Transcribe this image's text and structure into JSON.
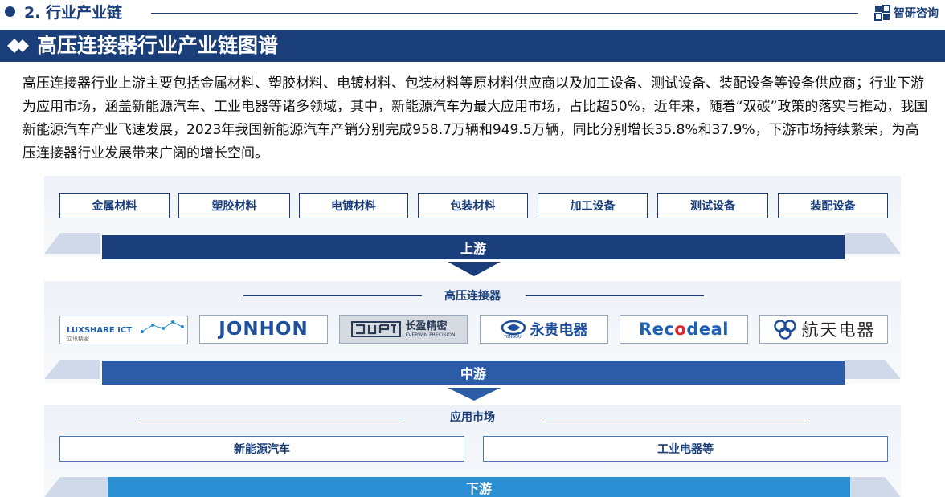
{
  "header": {
    "section_title": "2. 行业产业链",
    "brand": "智研咨询"
  },
  "banner": {
    "title": "高压连接器行业产业链图谱"
  },
  "intro": "高压连接器行业上游主要包括金属材料、塑胶材料、电镀材料、包装材料等原材料供应商以及加工设备、测试设备、装配设备等设备供应商；行业下游为应用市场，涵盖新能源汽车、工业电器等诸多领域，其中，新能源汽车为最大应用市场，占比超50%，近年来，随着“双碳”政策的落实与推动，我国新能源汽车产业飞速发展，2023年我国新能源汽车产销分别完成958.7万辆和949.5万辆，同比分别增长35.8%和37.9%，下游市场持续繁荣，为高压连接器行业发展带来广阔的增长空间。",
  "upstream": {
    "items": [
      "金属材料",
      "塑胶材料",
      "电镀材料",
      "包装材料",
      "加工设备",
      "测试设备",
      "装配设备"
    ],
    "bar_label": "上游"
  },
  "midstream": {
    "title": "高压连接器",
    "logos": [
      {
        "text": "LUXSHARE ICT",
        "sub": "立讯精密",
        "icon": "luxshare-constellation-icon"
      },
      {
        "text": "JONHON",
        "icon": "none"
      },
      {
        "text": "长盈精密",
        "sub": "EVERWIN PRECISION",
        "icon": "everwin-emblem-icon"
      },
      {
        "text": "永贵电器",
        "sub": "YONGGUI",
        "icon": "yonggui-swirl-icon"
      },
      {
        "text": "Recodeal",
        "icon": "none"
      },
      {
        "text": "航天电器",
        "icon": "aerospace-knot-icon"
      }
    ],
    "bar_label": "中游"
  },
  "downstream": {
    "title": "应用市场",
    "items": [
      "新能源汽车",
      "工业电器等"
    ],
    "bar_label": "下游"
  },
  "colors": {
    "primary": "#1a3e7a",
    "midbar": "#2c5ba8",
    "lowbar": "#2a8ed3",
    "jonhon": "#1d4f9c",
    "recodeal": "#1f5fb0",
    "recodeal_o": "#d7262c"
  }
}
